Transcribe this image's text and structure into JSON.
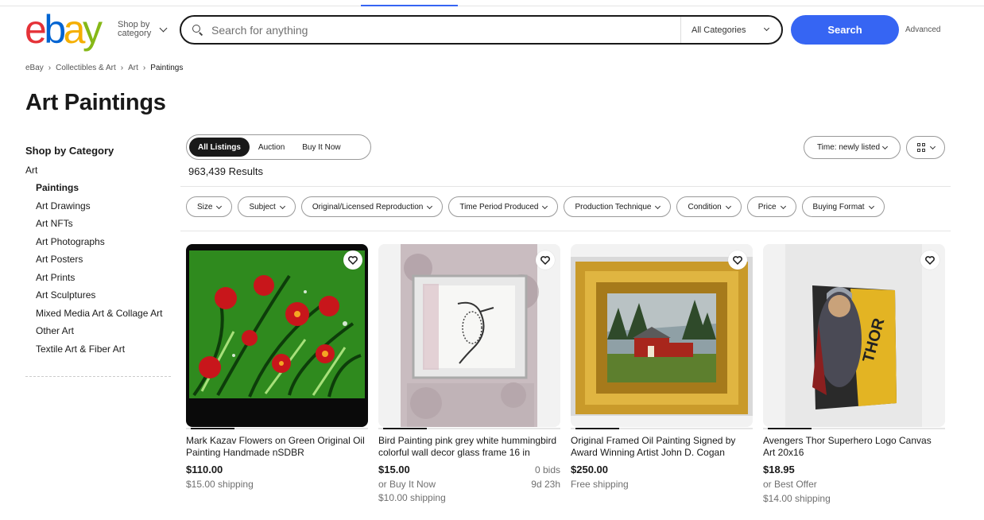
{
  "header": {
    "logo_letters": [
      "e",
      "b",
      "a",
      "y"
    ],
    "shop_by_category": "Shop by category",
    "search_placeholder": "Search for anything",
    "category_select": "All Categories",
    "search_button": "Search",
    "advanced_link": "Advanced"
  },
  "breadcrumb": [
    "eBay",
    "Collectibles & Art",
    "Art",
    "Paintings"
  ],
  "page_title": "Art Paintings",
  "sidebar": {
    "title": "Shop by Category",
    "root": "Art",
    "items": [
      {
        "label": "Paintings",
        "active": true
      },
      {
        "label": "Art Drawings"
      },
      {
        "label": "Art NFTs"
      },
      {
        "label": "Art Photographs"
      },
      {
        "label": "Art Posters"
      },
      {
        "label": "Art Prints"
      },
      {
        "label": "Art Sculptures"
      },
      {
        "label": "Mixed Media Art & Collage Art"
      },
      {
        "label": "Other Art"
      },
      {
        "label": "Textile Art & Fiber Art"
      }
    ]
  },
  "listing_toggle": {
    "all": "All Listings",
    "auction": "Auction",
    "buy_it_now": "Buy It Now",
    "selected": "All Listings"
  },
  "results_count": "963,439 Results",
  "sort": "Time: newly listed",
  "view_icon": "grid-view-icon",
  "filters": [
    "Size",
    "Subject",
    "Original/Licensed Reproduction",
    "Time Period Produced",
    "Production Technique",
    "Condition",
    "Price",
    "Buying Format"
  ],
  "listings": [
    {
      "title": "Mark Kazav Flowers on Green Original Oil Painting Handmade nSDBR",
      "price": "$110.00",
      "shipping": "$15.00 shipping"
    },
    {
      "title": "Bird Painting pink grey white hummingbird colorful wall decor glass frame 16 in",
      "price": "$15.00",
      "bids": "0 bids",
      "buy_now": "or Buy It Now",
      "time_left": "9d 23h",
      "shipping": "$10.00 shipping"
    },
    {
      "title": "Original Framed Oil Painting Signed by Award Winning Artist John D. Cogan",
      "price": "$250.00",
      "shipping": "Free shipping"
    },
    {
      "title": "Avengers Thor Superhero Logo Canvas Art 20x16",
      "price": "$18.95",
      "offer": "or Best Offer",
      "shipping": "$14.00 shipping"
    }
  ],
  "colors": {
    "accent_blue": "#3665f3",
    "logo_red": "#e53238",
    "logo_blue": "#0064d2",
    "logo_yellow": "#f5af02",
    "logo_green": "#86b817"
  }
}
